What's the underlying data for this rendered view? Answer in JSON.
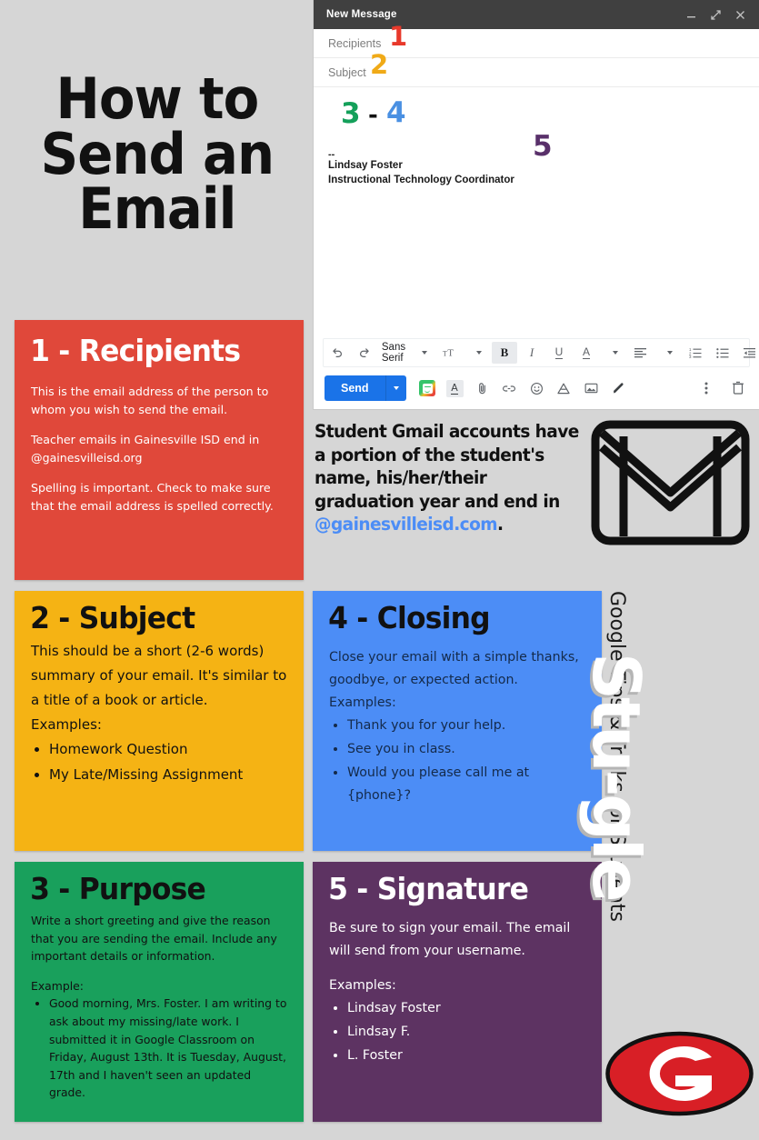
{
  "title": {
    "line1": "How to",
    "line2": "Send an",
    "line3": "Email"
  },
  "compose": {
    "window_title": "New Message",
    "window_buttons": {
      "minimize": "minimize-icon",
      "expand": "expand-icon",
      "close": "close-icon"
    },
    "fields": {
      "recipients_placeholder": "Recipients",
      "subject_placeholder": "Subject"
    },
    "body": {
      "dashes": "--",
      "signature_name": "Lindsay Foster",
      "signature_role": "Instructional Technology Coordinator"
    },
    "markers": {
      "m1": "1",
      "m2": "2",
      "m3": "3",
      "dash": "-",
      "m4": "4",
      "m5": "5",
      "color_1": "#e8392b",
      "color_2": "#f0aa17",
      "color_3": "#14a05a",
      "color_4": "#4a90e2",
      "color_5": "#59306a"
    },
    "format_toolbar": {
      "undo": "undo-icon",
      "redo": "redo-icon",
      "font_name": "Sans Serif",
      "font_size": "TT",
      "bold": "B",
      "italic": "I",
      "underline": "U",
      "text_color": "A",
      "align": "align-icon",
      "numbered_list": "numbered-list-icon",
      "bulleted_list": "bulleted-list-icon",
      "indent": "indent-icon",
      "more": "more-icon"
    },
    "send_bar": {
      "send_label": "Send",
      "send_color": "#1a73e8",
      "icons": [
        "bitmoji-icon",
        "formatting-options-icon",
        "attach-file-icon",
        "insert-link-icon",
        "insert-emoji-icon",
        "insert-drive-icon",
        "insert-photo-icon",
        "insert-signature-icon"
      ],
      "more_options": "more-options-icon",
      "discard": "trash-icon"
    }
  },
  "cards": [
    {
      "id": "recipients",
      "heading": "1 - Recipients",
      "color": "#e0483a",
      "paragraphs": [
        "This is the email address of the person to whom you wish to send the email.",
        "Teacher emails in Gainesville ISD end in @gainesvilleisd.org",
        "Spelling is important. Check to make sure that the email address is spelled correctly."
      ]
    },
    {
      "id": "subject",
      "heading": "2 - Subject",
      "color": "#f5b314",
      "paragraphs": [
        "This should be a short (2-6 words) summary of your email. It's similar to a title of a book or article.",
        "Examples:"
      ],
      "bullets": [
        "Homework Question",
        "My Late/Missing Assignment"
      ]
    },
    {
      "id": "purpose",
      "heading": "3 - Purpose",
      "color": "#19a05c",
      "paragraphs": [
        "Write a short greeting and give the reason that you are sending the email. Include any important details or information.",
        "Example:"
      ],
      "bullets": [
        "Good morning, Mrs. Foster. I am writing to ask about my missing/late work. I submitted it in Google Classroom on Friday, August 13th. It is Tuesday, August, 17th and I haven't seen an updated grade."
      ]
    },
    {
      "id": "closing",
      "heading": "4 - Closing",
      "color": "#4c8df6",
      "paragraphs": [
        "Close your email with a simple thanks, goodbye, or expected action.",
        "Examples:"
      ],
      "bullets": [
        "Thank you for your help.",
        "See you in class.",
        "Would you please call me at {phone}?"
      ]
    },
    {
      "id": "signature",
      "heading": "5 - Signature",
      "color": "#5d3362",
      "paragraphs": [
        "Be sure to sign your email. The email will send from your username.",
        "Examples:"
      ],
      "bullets": [
        "Lindsay Foster",
        "Lindsay F.",
        "L. Foster"
      ]
    }
  ],
  "student_note": {
    "text": "Student Gmail accounts have a portion of the student's name, his/her/their graduation year and end in ",
    "domain": "@gainesvilleisd.com",
    "period": ".",
    "domain_color": "#4c8df6",
    "envelope_icon": "envelope-icon"
  },
  "branding": {
    "tagline": "Google Tips & Tricks for Students",
    "wordmark": "Stu-gle",
    "logo_letter": "G",
    "logo_color": "#d81f26"
  }
}
